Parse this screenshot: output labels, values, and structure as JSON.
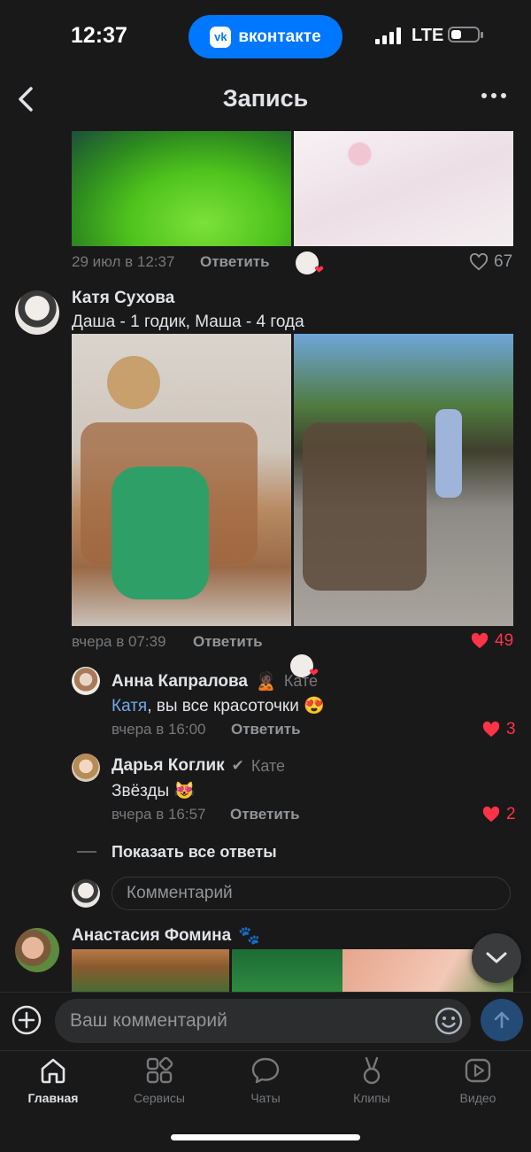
{
  "status_bar": {
    "time": "12:37",
    "app_pill": "вконтакте",
    "app_pill_logo": "vk",
    "network": "LTE"
  },
  "header": {
    "title": "Запись"
  },
  "top_comment": {
    "date": "29 июл в 12:37",
    "reply_label": "Ответить",
    "likes": "67"
  },
  "main_comment": {
    "author": "Катя Сухова",
    "text": "Даша - 1 годик, Маша - 4 года",
    "date": "вчера в 07:39",
    "reply_label": "Ответить",
    "likes": "49"
  },
  "replies": [
    {
      "author": "Анна Капралова",
      "badge": "🙎🏿",
      "to": "Кате",
      "mention": "Катя",
      "text": ", вы все красоточки 😍",
      "date": "вчера в 16:00",
      "reply_label": "Ответить",
      "likes": "3"
    },
    {
      "author": "Дарья Коглик",
      "badge": "✔",
      "to": "Кате",
      "text": "Звёзды 😻",
      "date": "вчера в 16:57",
      "reply_label": "Ответить",
      "likes": "2"
    }
  ],
  "show_all_replies": "Показать все ответы",
  "reply_input_placeholder": "Комментарий",
  "next_comment": {
    "author": "Анастасия Фомина",
    "badge": "🐾"
  },
  "bottom_input": {
    "placeholder": "Ваш комментарий"
  },
  "tabs": [
    {
      "label": "Главная",
      "icon": "home-icon",
      "active": true
    },
    {
      "label": "Сервисы",
      "icon": "services-icon",
      "active": false
    },
    {
      "label": "Чаты",
      "icon": "chat-icon",
      "active": false
    },
    {
      "label": "Клипы",
      "icon": "clips-icon",
      "active": false
    },
    {
      "label": "Видео",
      "icon": "video-icon",
      "active": false
    }
  ],
  "colors": {
    "accent": "#0077ff",
    "like": "#ff3347",
    "background": "#19191a",
    "mention": "#71aaeb"
  }
}
